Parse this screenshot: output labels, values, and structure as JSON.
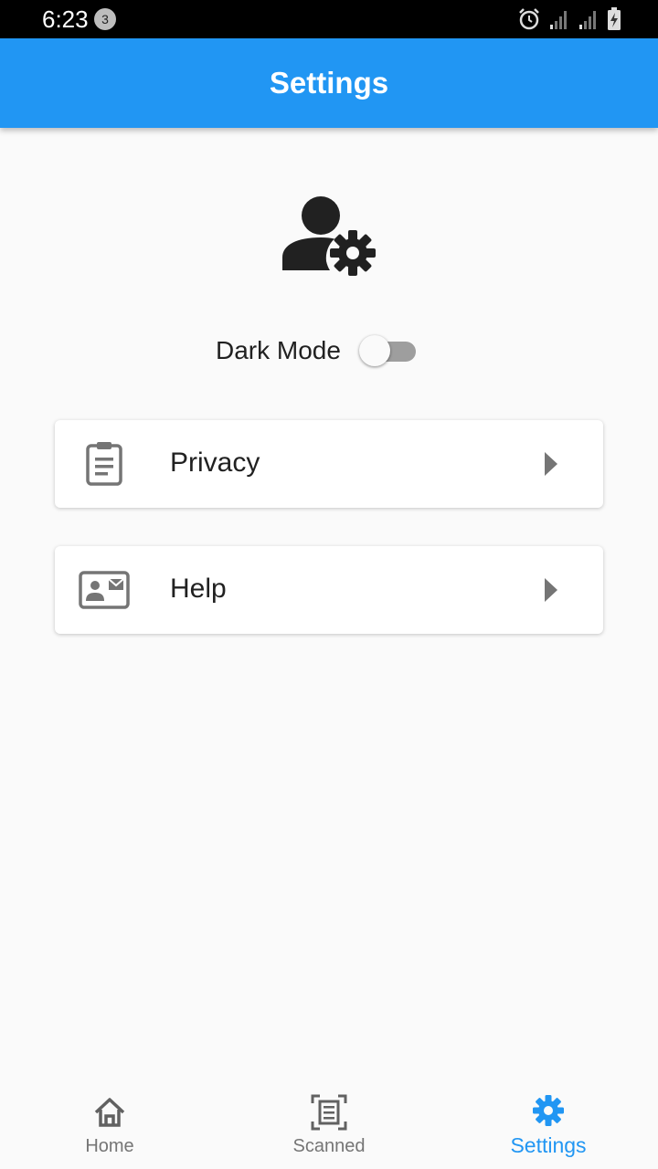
{
  "status_bar": {
    "time": "6:23",
    "notification_count": "3",
    "icons": [
      "alarm-icon",
      "signal-icon",
      "signal-icon",
      "battery-charging-icon"
    ]
  },
  "app_bar": {
    "title": "Settings",
    "color": "#2196f3"
  },
  "profile": {
    "icon": "manage-accounts-icon"
  },
  "dark_mode": {
    "label": "Dark Mode",
    "enabled": false
  },
  "menu": [
    {
      "label": "Privacy",
      "icon": "clipboard-icon"
    },
    {
      "label": "Help",
      "icon": "contact-mail-icon"
    }
  ],
  "bottom_nav": {
    "items": [
      {
        "label": "Home",
        "icon": "home-icon",
        "active": false
      },
      {
        "label": "Scanned",
        "icon": "document-scanner-icon",
        "active": false
      },
      {
        "label": "Settings",
        "icon": "gear-icon",
        "active": true
      }
    ],
    "active_color": "#2196f3"
  }
}
